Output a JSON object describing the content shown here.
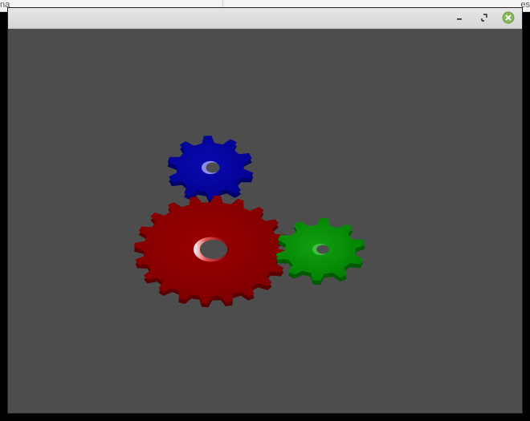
{
  "background": {
    "left_fragment": "na",
    "right_fragment": "es"
  },
  "window": {
    "title": "",
    "buttons": {
      "minimize_icon": "minimize-icon",
      "maximize_icon": "maximize-icon",
      "close_icon": "close-icon"
    },
    "canvas_color": "#4d4d4d"
  },
  "scene": {
    "gears": [
      {
        "name": "red-gear",
        "color": "#8b0000",
        "teeth": 20
      },
      {
        "name": "blue-gear",
        "color": "#0000a0",
        "teeth": 10
      },
      {
        "name": "green-gear",
        "color": "#009000",
        "teeth": 10
      }
    ]
  }
}
